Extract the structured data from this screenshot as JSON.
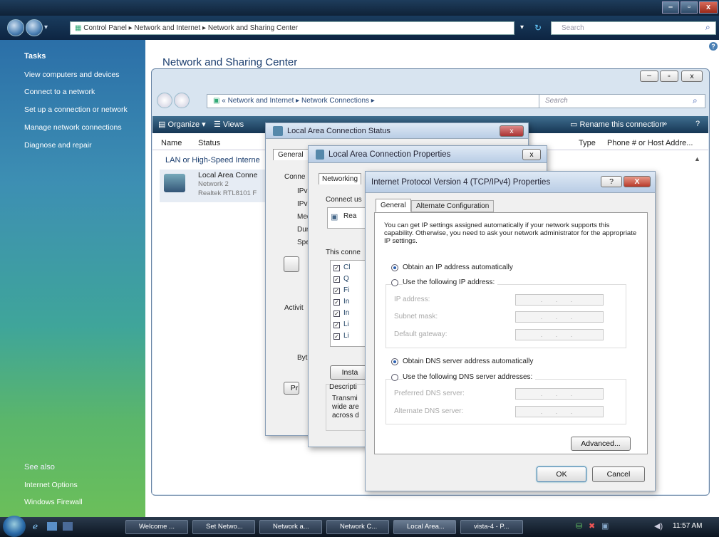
{
  "outer_window": {
    "breadcrumb": [
      "Control Panel",
      "Network and Internet",
      "Network and Sharing Center"
    ],
    "search_placeholder": "Search",
    "caption_buttons": [
      "–",
      "▫",
      "x"
    ]
  },
  "tasks_pane": {
    "title": "Tasks",
    "items": [
      "View computers and devices",
      "Connect to a network",
      "Set up a connection or network",
      "Manage network connections",
      "Diagnose and repair"
    ],
    "see_also_title": "See also",
    "see_also_items": [
      "Internet Options",
      "Windows Firewall"
    ]
  },
  "main": {
    "title": "Network and Sharing Center"
  },
  "network_connections": {
    "breadcrumb": "« Network and Internet ▸ Network Connections ▸",
    "search_placeholder": "Search",
    "toolbar": {
      "organize": "Organize ▾",
      "views": "Views",
      "rename": "Rename this connection",
      "more": "»"
    },
    "columns": [
      "Name",
      "Status",
      "Type",
      "Phone # or Host Addre..."
    ],
    "group_label": "LAN or High-Speed Interne",
    "item": {
      "name": "Local Area Conne",
      "network": "Network 2",
      "adapter": "Realtek RTL8101 F"
    }
  },
  "status_dialog": {
    "title": "Local Area Connection Status",
    "tab": "General",
    "labels": [
      "Conne",
      "IPv",
      "IPv",
      "Med",
      "Dur",
      "Spe",
      "Activit",
      "Byt"
    ]
  },
  "properties_dialog": {
    "title": "Local Area Connection Properties",
    "tab": "Networking",
    "connect_using": "Connect us",
    "adapter_short": "Rea",
    "this_connection": "This conne",
    "items": [
      "Cl",
      "Q",
      "Fi",
      "In",
      "In",
      "Li",
      "Li"
    ],
    "install_button": "Insta",
    "properties_button": "Pr",
    "description_label": "Descripti",
    "description_lines": [
      "Transmi",
      "wide are",
      "across d"
    ]
  },
  "ipv4_dialog": {
    "title": "Internet Protocol Version 4 (TCP/IPv4) Properties",
    "help": "?",
    "close": "X",
    "tabs": [
      "General",
      "Alternate Configuration"
    ],
    "description": "You can get IP settings assigned automatically if your network supports this capability. Otherwise, you need to ask your network administrator for the appropriate IP settings.",
    "obtain_ip_auto": "Obtain an IP address automatically",
    "use_following_ip": "Use the following IP address:",
    "ip_address_label": "IP address:",
    "subnet_mask_label": "Subnet mask:",
    "default_gateway_label": "Default gateway:",
    "obtain_dns_auto": "Obtain DNS server address automatically",
    "use_following_dns": "Use the following DNS server addresses:",
    "preferred_dns_label": "Preferred DNS server:",
    "alternate_dns_label": "Alternate DNS server:",
    "advanced_button": "Advanced...",
    "ok_button": "OK",
    "cancel_button": "Cancel",
    "ip_mode": "automatic",
    "dns_mode": "automatic",
    "empty_ip": ". . ."
  },
  "taskbar": {
    "buttons": [
      "Welcome ...",
      "Set Netwo...",
      "Network a...",
      "Network C...",
      "Local Area...",
      "vista-4 - P..."
    ],
    "clock": "11:57 AM"
  }
}
